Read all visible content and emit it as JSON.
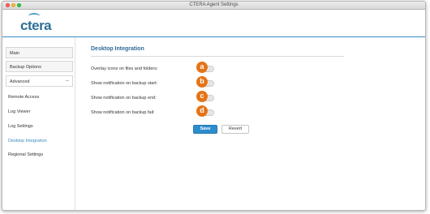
{
  "window": {
    "title": "CTERA Agent Settings"
  },
  "header": {
    "logo_text": "ctera"
  },
  "sidebar": {
    "sections": [
      {
        "label": "Main",
        "sign": ""
      },
      {
        "label": "Backup Options",
        "sign": ""
      },
      {
        "label": "Advanced",
        "sign": "–"
      }
    ],
    "items": [
      {
        "label": "Remote Access",
        "active": false
      },
      {
        "label": "Log Viewer",
        "active": false
      },
      {
        "label": "Log Settings",
        "active": false
      },
      {
        "label": "Desktop Integration",
        "active": true
      },
      {
        "label": "Regional Settings",
        "active": false
      }
    ]
  },
  "content": {
    "title": "Desktop Integration",
    "rows": [
      {
        "label": "Overlay icons on files and folders:",
        "callout": "a",
        "enabled": false
      },
      {
        "label": "Show notification on backup start:",
        "callout": "b",
        "enabled": false
      },
      {
        "label": "Show notification on backup end:",
        "callout": "c",
        "enabled": false
      },
      {
        "label": "Show notification on backup fail:",
        "callout": "d",
        "enabled": false
      }
    ],
    "save_label": "Save",
    "revert_label": "Revert"
  },
  "colors": {
    "accent": "#3b8cc0",
    "title": "#2c6a96",
    "callout": "#e57417",
    "save_button": "#2d8ccc"
  }
}
